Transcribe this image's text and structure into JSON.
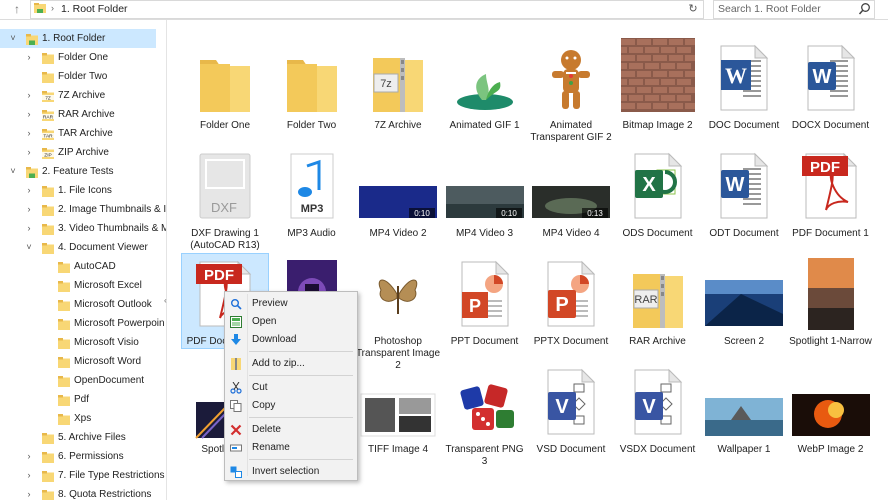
{
  "address": {
    "path": "1. Root Folder",
    "separator": "›"
  },
  "search": {
    "placeholder": "Search 1. Root Folder"
  },
  "sidebar": {
    "items": [
      {
        "label": "1. Root Folder",
        "chev": "˅",
        "icon": "root",
        "level": 0,
        "selected": true
      },
      {
        "label": "Folder One",
        "chev": "›",
        "icon": "folder",
        "level": 1
      },
      {
        "label": "Folder Two",
        "chev": "",
        "icon": "folder",
        "level": 1
      },
      {
        "label": "7Z Archive",
        "chev": "›",
        "icon": "7z",
        "level": 1
      },
      {
        "label": "RAR Archive",
        "chev": "›",
        "icon": "rar",
        "level": 1
      },
      {
        "label": "TAR Archive",
        "chev": "›",
        "icon": "tar",
        "level": 1
      },
      {
        "label": "ZIP Archive",
        "chev": "›",
        "icon": "zip",
        "level": 1
      },
      {
        "label": "2. Feature Tests",
        "chev": "˅",
        "icon": "root",
        "level": 0
      },
      {
        "label": "1. File Icons",
        "chev": "›",
        "icon": "folder",
        "level": 1
      },
      {
        "label": "2. Image Thumbnails & I",
        "chev": "›",
        "icon": "folder",
        "level": 1
      },
      {
        "label": "3. Video Thumbnails & M",
        "chev": "›",
        "icon": "folder",
        "level": 1
      },
      {
        "label": "4. Document Viewer",
        "chev": "˅",
        "icon": "folder",
        "level": 1
      },
      {
        "label": "AutoCAD",
        "chev": "",
        "icon": "folder",
        "level": 2
      },
      {
        "label": "Microsoft Excel",
        "chev": "",
        "icon": "folder",
        "level": 2
      },
      {
        "label": "Microsoft Outlook",
        "chev": "",
        "icon": "folder",
        "level": 2
      },
      {
        "label": "Microsoft Powerpoin",
        "chev": "",
        "icon": "folder",
        "level": 2
      },
      {
        "label": "Microsoft Visio",
        "chev": "",
        "icon": "folder",
        "level": 2
      },
      {
        "label": "Microsoft Word",
        "chev": "",
        "icon": "folder",
        "level": 2
      },
      {
        "label": "OpenDocument",
        "chev": "",
        "icon": "folder",
        "level": 2
      },
      {
        "label": "Pdf",
        "chev": "",
        "icon": "folder",
        "level": 2
      },
      {
        "label": "Xps",
        "chev": "",
        "icon": "folder",
        "level": 2
      },
      {
        "label": "5. Archive Files",
        "chev": "",
        "icon": "folder",
        "level": 1
      },
      {
        "label": "6. Permissions",
        "chev": "›",
        "icon": "folder",
        "level": 1
      },
      {
        "label": "7. File Type Restrictions",
        "chev": "›",
        "icon": "folder",
        "level": 1
      },
      {
        "label": "8. Quota Restrictions",
        "chev": "›",
        "icon": "folder",
        "level": 1
      }
    ]
  },
  "files": [
    {
      "name": "Folder One",
      "kind": "folder"
    },
    {
      "name": "Folder Two",
      "kind": "folder"
    },
    {
      "name": "7Z Archive",
      "kind": "archive",
      "badge": "7z"
    },
    {
      "name": "Animated GIF 1",
      "kind": "gif1"
    },
    {
      "name": "Animated Transparent GIF 2",
      "kind": "ginger"
    },
    {
      "name": "Bitmap Image 2",
      "kind": "brick"
    },
    {
      "name": "DOC Document",
      "kind": "word-old"
    },
    {
      "name": "DOCX Document",
      "kind": "word"
    },
    {
      "name": "DXF Drawing 1 (AutoCAD R13)",
      "kind": "dxf",
      "badge": "DXF"
    },
    {
      "name": "MP3 Audio",
      "kind": "mp3",
      "badge": "MP3"
    },
    {
      "name": "MP4 Video 2",
      "kind": "video-blue",
      "badge": "0:10"
    },
    {
      "name": "MP4 Video 3",
      "kind": "video-sea",
      "badge": "0:10"
    },
    {
      "name": "MP4 Video 4",
      "kind": "video-dark",
      "badge": "0:13"
    },
    {
      "name": "ODS Document",
      "kind": "excel"
    },
    {
      "name": "ODT Document",
      "kind": "word"
    },
    {
      "name": "PDF Document 1",
      "kind": "pdf",
      "badge": "PDF"
    },
    {
      "name": "PDF Document 2",
      "kind": "pdf",
      "badge": "PDF",
      "selected": true
    },
    {
      "name": "",
      "kind": "poster"
    },
    {
      "name": "Photoshop Transparent Image 2",
      "kind": "butterfly"
    },
    {
      "name": "PPT Document",
      "kind": "ppt-old"
    },
    {
      "name": "PPTX Document",
      "kind": "ppt"
    },
    {
      "name": "RAR Archive",
      "kind": "archive",
      "badge": "RAR"
    },
    {
      "name": "Screen 2",
      "kind": "screen"
    },
    {
      "name": "Spotlight 1-Narrow",
      "kind": "spotlight"
    },
    {
      "name": "Spotlight 2",
      "kind": "tunnel"
    },
    {
      "name": "",
      "kind": "none"
    },
    {
      "name": "TIFF Image 4",
      "kind": "tiff"
    },
    {
      "name": "Transparent PNG 3",
      "kind": "dice"
    },
    {
      "name": "VSD Document",
      "kind": "visio"
    },
    {
      "name": "VSDX Document",
      "kind": "visio"
    },
    {
      "name": "Wallpaper 1",
      "kind": "wallpaper"
    },
    {
      "name": "WebP Image 2",
      "kind": "webp"
    }
  ],
  "context_menu": {
    "items": [
      {
        "label": "Preview",
        "icon": "preview-icon"
      },
      {
        "label": "Open",
        "icon": "open-icon"
      },
      {
        "label": "Download",
        "icon": "download-icon"
      },
      {
        "sep": true
      },
      {
        "label": "Add to zip...",
        "icon": "zip-icon"
      },
      {
        "sep": true
      },
      {
        "label": "Cut",
        "icon": "cut-icon"
      },
      {
        "label": "Copy",
        "icon": "copy-icon"
      },
      {
        "sep": true
      },
      {
        "label": "Delete",
        "icon": "delete-icon"
      },
      {
        "label": "Rename",
        "icon": "rename-icon"
      },
      {
        "sep": true
      },
      {
        "label": "Invert selection",
        "icon": "invert-selection-icon"
      }
    ]
  },
  "colors": {
    "selection": "#cce8ff",
    "folder": "#f8d775",
    "folder_dark": "#e8b84a",
    "word": "#2b579a",
    "excel": "#217346",
    "ppt": "#d24726",
    "pdf": "#c8281e",
    "visio": "#3955a3"
  }
}
